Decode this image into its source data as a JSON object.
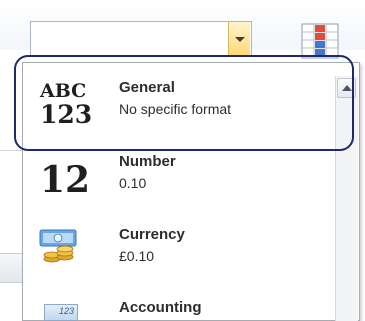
{
  "number_format_gallery": {
    "items": [
      {
        "label": "General",
        "description": "No specific format",
        "icon": "abc-123-icon",
        "icon_text_line1": "ABC",
        "icon_text_line2": "123"
      },
      {
        "label": "Number",
        "description": "0.10",
        "icon": "number-12-icon",
        "icon_text": "12"
      },
      {
        "label": "Currency",
        "description": "£0.10",
        "icon": "currency-coins-icon"
      },
      {
        "label": "Accounting",
        "description": "",
        "icon": "accounting-ledger-icon",
        "icon_text": "123"
      }
    ]
  },
  "colors": {
    "highlight_ring": "#1d2a6b",
    "combo_button": "#ffd977"
  }
}
